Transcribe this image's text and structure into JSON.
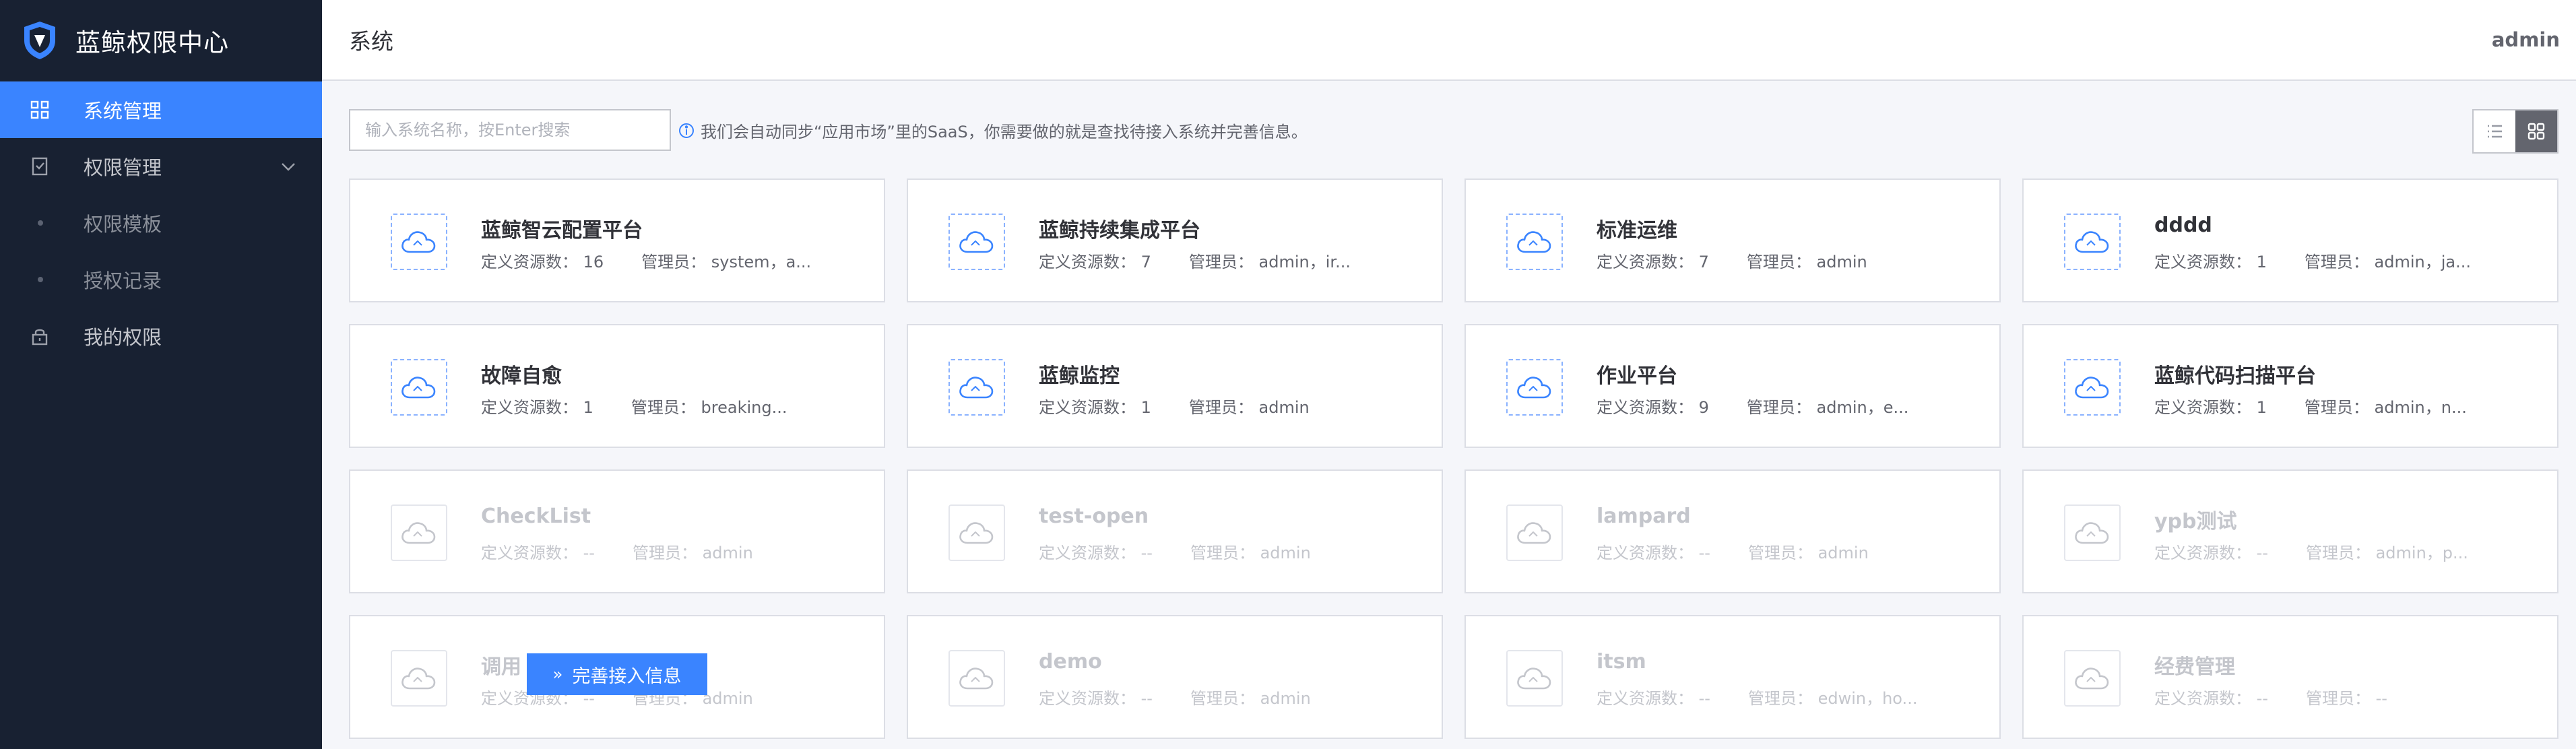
{
  "app": {
    "title": "蓝鲸权限中心"
  },
  "sidebar": {
    "items": [
      {
        "label": "系统管理"
      },
      {
        "label": "权限管理"
      },
      {
        "label": "权限模板"
      },
      {
        "label": "授权记录"
      },
      {
        "label": "我的权限"
      }
    ]
  },
  "header": {
    "title": "系统",
    "user": "admin"
  },
  "toolbar": {
    "search_placeholder": "输入系统名称，按Enter搜索",
    "tip": "我们会自动同步“应用市场”里的SaaS，你需要做的就是查找待接入系统并完善信息。"
  },
  "colors": {
    "accent": "#3a84ff",
    "sidebar_bg": "#182132"
  },
  "cards": [
    {
      "name": "蓝鲸智云配置平台",
      "resources": "定义资源数：  16",
      "managers": "管理员：  system，a..."
    },
    {
      "name": "蓝鲸持续集成平台",
      "resources": "定义资源数：  7",
      "managers": "管理员：  admin，ir..."
    },
    {
      "name": "标准运维",
      "resources": "定义资源数：  7",
      "managers": "管理员：  admin"
    },
    {
      "name": "dddd",
      "resources": "定义资源数：  1",
      "managers": "管理员：  admin，ja..."
    },
    {
      "name": "故障自愈",
      "resources": "定义资源数：  1",
      "managers": "管理员：  breaking..."
    },
    {
      "name": "蓝鲸监控",
      "resources": "定义资源数：  1",
      "managers": "管理员：  admin"
    },
    {
      "name": "作业平台",
      "resources": "定义资源数：  9",
      "managers": "管理员：  admin，e..."
    },
    {
      "name": "蓝鲸代码扫描平台",
      "resources": "定义资源数：  1",
      "managers": "管理员：  admin，n..."
    },
    {
      "name": "CheckList",
      "resources": "定义资源数：  --",
      "managers": "管理员：  admin"
    },
    {
      "name": "test-open",
      "resources": "定义资源数：  --",
      "managers": "管理员：  admin"
    },
    {
      "name": "lampard",
      "resources": "定义资源数：  --",
      "managers": "管理员：  admin"
    },
    {
      "name": "ypb测试",
      "resources": "定义资源数：  --",
      "managers": "管理员：  admin，p..."
    },
    {
      "name": "调用",
      "resources": "定义资源数：  --",
      "managers": "管理员：  admin"
    },
    {
      "name": "demo",
      "resources": "定义资源数：  --",
      "managers": "管理员：  admin"
    },
    {
      "name": "itsm",
      "resources": "定义资源数：  --",
      "managers": "管理员：  edwin，ho..."
    },
    {
      "name": "经费管理",
      "resources": "定义资源数：  --",
      "managers": "管理员：  --"
    }
  ],
  "float_button": {
    "label": "完善接入信息",
    "icon": "»"
  }
}
